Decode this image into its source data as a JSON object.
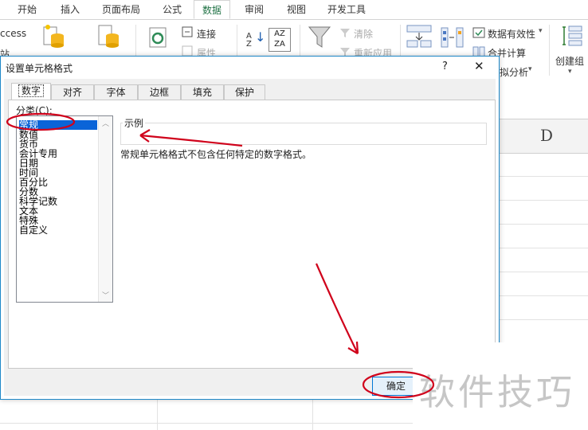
{
  "ribbon_tabs": [
    "开始",
    "插入",
    "页面布局",
    "公式",
    "数据",
    "审阅",
    "视图",
    "开发工具"
  ],
  "active_tab": "数据",
  "ribbon": {
    "access": "ccess",
    "website": "站",
    "connect": "连接",
    "properties": "属性",
    "clear": "清除",
    "reapply": "重新应用",
    "data_validation": "数据有效性",
    "consolidate": "合并计算",
    "whatif": "拟分析",
    "create_group": "创建组",
    "sort_az": "AZ",
    "sort_za": "ZA"
  },
  "column_header": "D",
  "dialog": {
    "title": "设置单元格格式",
    "help": "?",
    "close": "✕",
    "tabs": [
      "数字",
      "对齐",
      "字体",
      "边框",
      "填充",
      "保护"
    ],
    "selected_tab": "数字",
    "category_label": "分类(C):",
    "categories": [
      "常规",
      "数值",
      "货币",
      "会计专用",
      "日期",
      "时间",
      "百分比",
      "分数",
      "科学记数",
      "文本",
      "特殊",
      "自定义"
    ],
    "selected_category": "常规",
    "sample_label": "示例",
    "description": "常规单元格格式不包含任何特定的数字格式。",
    "ok_label": "确定"
  },
  "annotation_color": "#d0021b",
  "watermark": "软件技巧"
}
